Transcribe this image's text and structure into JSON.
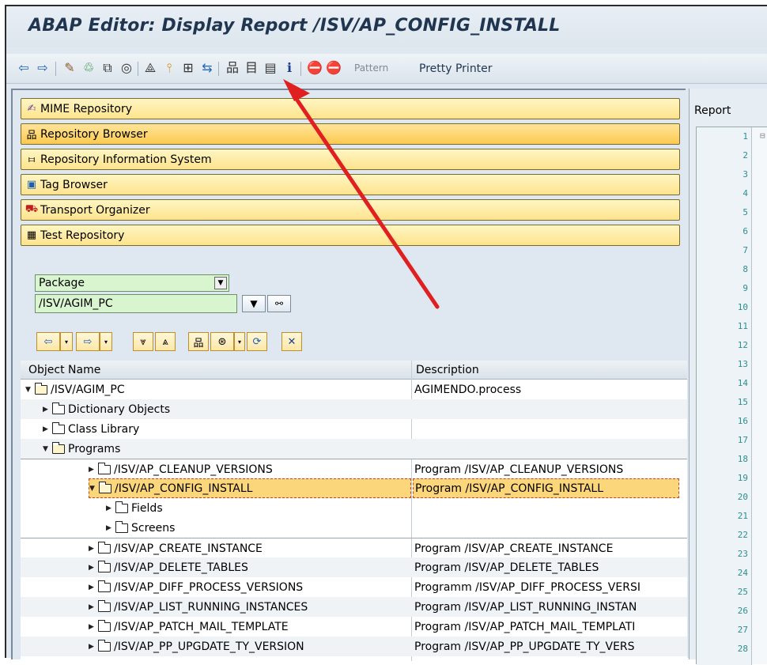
{
  "window": {
    "title": "ABAP Editor: Display Report /ISV/AP_CONFIG_INSTALL"
  },
  "toolbar": {
    "icons": [
      "back-icon",
      "forward-icon",
      "change-display-icon",
      "active-inactive-icon",
      "other-object-icon",
      "check-icon",
      "activate-icon",
      "test-icon",
      "where-used-icon",
      "display-object-list-icon",
      "display-navigation-window-icon",
      "fullscreen-icon",
      "info-icon",
      "set-breakpoint-icon",
      "session-breakpoint-icon"
    ],
    "pattern_label": "Pattern",
    "pretty_printer_label": "Pretty Printer"
  },
  "object_browser": {
    "buttons": [
      {
        "label": "MIME Repository",
        "icon": "mime-icon"
      },
      {
        "label": "Repository Browser",
        "icon": "hierarchy-icon"
      },
      {
        "label": "Repository Information System",
        "icon": "info-system-icon"
      },
      {
        "label": "Tag Browser",
        "icon": "tag-icon"
      },
      {
        "label": "Transport Organizer",
        "icon": "truck-icon"
      },
      {
        "label": "Test Repository",
        "icon": "test-repo-icon"
      }
    ],
    "object_type": "Package",
    "object_value": "/ISV/AGIM_PC"
  },
  "grid": {
    "headers": {
      "name": "Object Name",
      "description": "Description"
    },
    "rows": [
      {
        "level": 0,
        "expanded": true,
        "name": "/ISV/AGIM_PC",
        "description": "AGIMENDO.process"
      },
      {
        "level": 1,
        "expanded": false,
        "name": "Dictionary Objects",
        "description": ""
      },
      {
        "level": 1,
        "expanded": false,
        "name": "Class Library",
        "description": ""
      },
      {
        "level": 1,
        "expanded": true,
        "name": "Programs",
        "description": ""
      },
      {
        "level": 2,
        "expanded": false,
        "name": "/ISV/AP_CLEANUP_VERSIONS",
        "description": "Program /ISV/AP_CLEANUP_VERSIONS"
      },
      {
        "level": 2,
        "expanded": true,
        "name": "/ISV/AP_CONFIG_INSTALL",
        "description": "Program /ISV/AP_CONFIG_INSTALL",
        "selected": true
      },
      {
        "level": 3,
        "expanded": false,
        "name": "Fields",
        "description": ""
      },
      {
        "level": 3,
        "expanded": false,
        "name": "Screens",
        "description": ""
      },
      {
        "level": 2,
        "expanded": false,
        "name": "/ISV/AP_CREATE_INSTANCE",
        "description": "Program /ISV/AP_CREATE_INSTANCE"
      },
      {
        "level": 2,
        "expanded": false,
        "name": "/ISV/AP_DELETE_TABLES",
        "description": "Program /ISV/AP_DELETE_TABLES"
      },
      {
        "level": 2,
        "expanded": false,
        "name": "/ISV/AP_DIFF_PROCESS_VERSIONS",
        "description": "Programm /ISV/AP_DIFF_PROCESS_VERSI"
      },
      {
        "level": 2,
        "expanded": false,
        "name": "/ISV/AP_LIST_RUNNING_INSTANCES",
        "description": "Program /ISV/AP_LIST_RUNNING_INSTAN"
      },
      {
        "level": 2,
        "expanded": false,
        "name": "/ISV/AP_PATCH_MAIL_TEMPLATE",
        "description": "Program /ISV/AP_PATCH_MAIL_TEMPLATI"
      },
      {
        "level": 2,
        "expanded": false,
        "name": "/ISV/AP_PP_UPGDATE_TY_VERSION",
        "description": "Program /ISV/AP_PP_UPGDATE_TY_VERS"
      }
    ]
  },
  "editor": {
    "section_label": "Report",
    "line_numbers": [
      "1",
      "2",
      "3",
      "4",
      "5",
      "6",
      "7",
      "8",
      "9",
      "10",
      "11",
      "12",
      "13",
      "14",
      "15",
      "16",
      "17",
      "18",
      "19",
      "20",
      "21",
      "22",
      "23",
      "24",
      "25",
      "26",
      "27",
      "28"
    ]
  },
  "colors": {
    "accent_button": "#fde38b",
    "selection": "#fcd67b",
    "annotation_arrow": "#e02020",
    "input_bg": "#d9f5d0",
    "line_number": "#2c8f8f"
  }
}
